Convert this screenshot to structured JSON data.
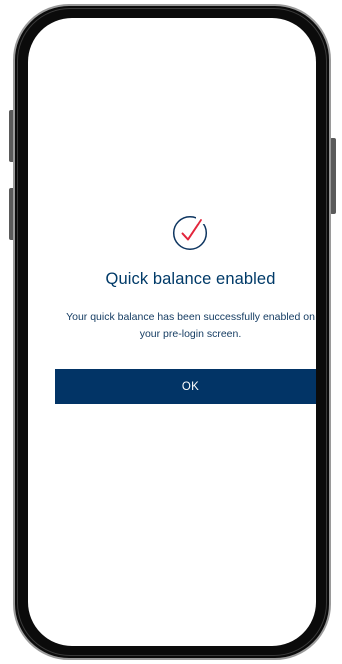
{
  "dialog": {
    "icon": "check-circle-icon",
    "title": "Quick balance enabled",
    "message": "Your quick balance has been successfully enabled on your pre-login screen.",
    "ok_label": "OK"
  },
  "colors": {
    "primary": "#023466",
    "title_text": "#003a68",
    "check_mark": "#e3263c",
    "background": "#ffffff"
  }
}
